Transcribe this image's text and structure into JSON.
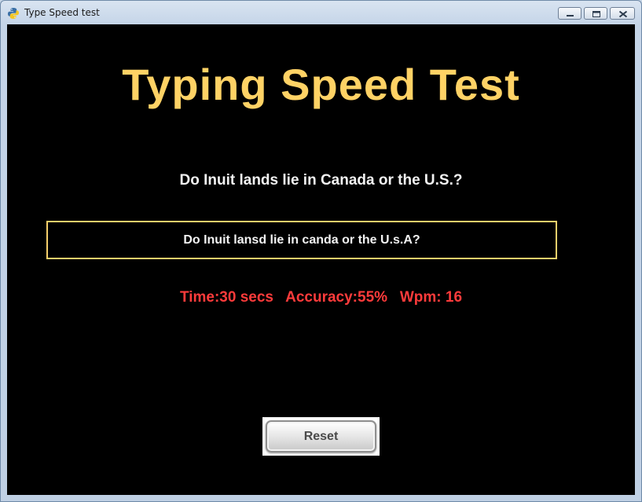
{
  "window": {
    "title": "Type Speed test",
    "app_icon": "python-snake-icon",
    "controls": [
      "minimize-icon",
      "maximize-icon",
      "close-icon"
    ]
  },
  "app": {
    "heading": "Typing Speed Test",
    "sentence": "Do Inuit lands lie in Canada or the U.S.?",
    "input_value": "Do Inuit lansd lie in canda or the U.s.A?",
    "results": {
      "time_label": "Time:",
      "time_value": "30 secs",
      "accuracy_label": "Accuracy:",
      "accuracy_value": "55%",
      "wpm_label": "Wpm: ",
      "wpm_value": "16"
    },
    "reset_label": "Reset"
  },
  "colors": {
    "background": "#000000",
    "heading": "#ffd265",
    "text": "#f2f2f2",
    "input_border": "#f5cf6b",
    "results": "#ff3b3b"
  }
}
